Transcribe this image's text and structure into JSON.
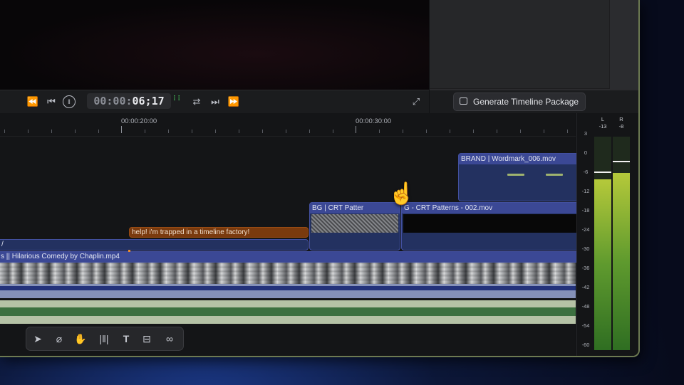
{
  "transport": {
    "timecode_dim": "00:00:",
    "timecode_bright": "06;17",
    "buttons": [
      "rewind",
      "previous",
      "pause",
      "loop",
      "next",
      "fast-forward",
      "fullscreen"
    ]
  },
  "inspector": {
    "generate_label": "Generate Timeline Package"
  },
  "ruler": {
    "labels": [
      "00:00:20:00",
      "00:00:30:00"
    ]
  },
  "clips": {
    "brand": "BRAND | Wordmark_006.mov",
    "bg_crt_a": "BG | CRT Patter",
    "bg_crt_b": "G - CRT Patterns - 002.mov",
    "orange": "help! i'm trapped in a timeline factory!",
    "main_video": "s || Hilarious Comedy by Chaplin.mp4",
    "left_slice": "/"
  },
  "meters": {
    "left_label": "L",
    "right_label": "R",
    "left_value": "-13",
    "right_value": "-8",
    "left_level": 0.8,
    "right_level": 0.83,
    "left_peak": 0.83,
    "right_peak": 0.88,
    "scale": [
      "3",
      "0",
      "-6",
      "-12",
      "-18",
      "-24",
      "-30",
      "-36",
      "-42",
      "-48",
      "-54",
      "-60",
      "-∞"
    ]
  },
  "tools": [
    "select-tool",
    "blade-tool",
    "hand-tool",
    "trim-tool",
    "text-tool",
    "caption-tool",
    "link-tool"
  ],
  "colors": {
    "clip_blue": "#233160",
    "clip_orange": "#7a3a0e",
    "audio_blue": "#23327a",
    "audio_green": "#3c7040"
  }
}
